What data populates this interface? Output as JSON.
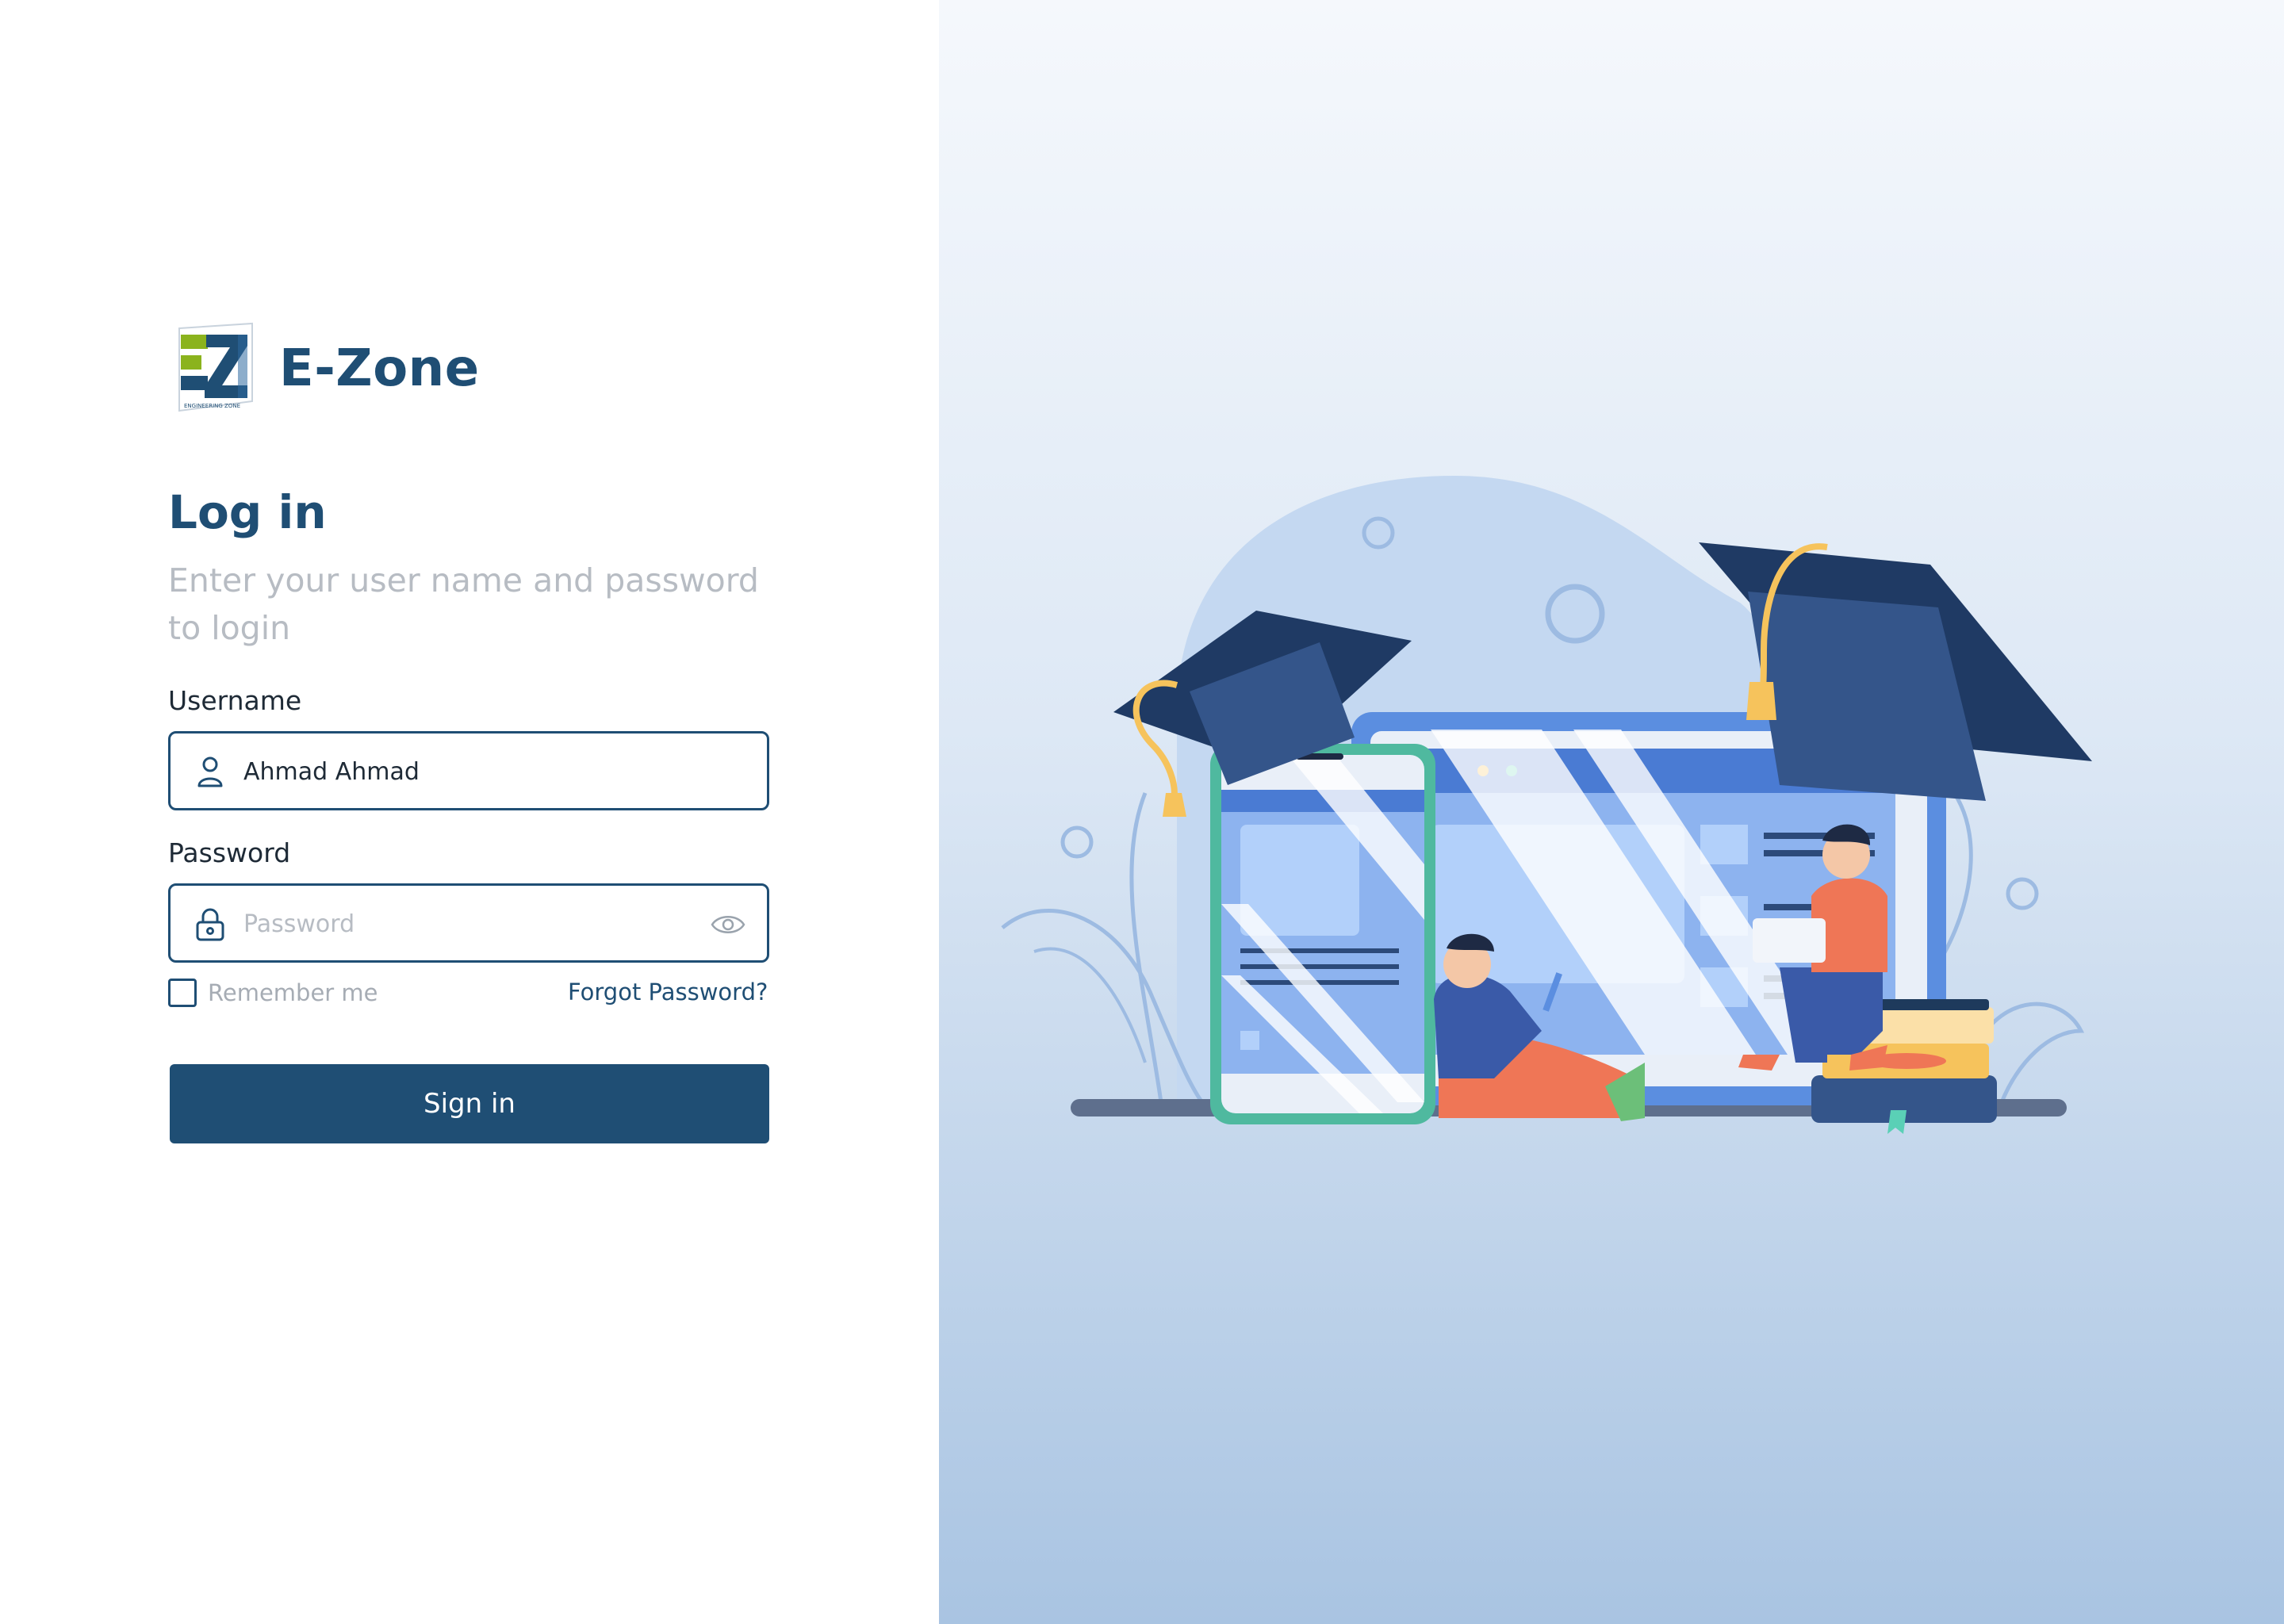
{
  "brand": {
    "name": "E-Zone",
    "logo_letters": "EZ",
    "logo_tagline": "ENGINEERING ZONE"
  },
  "login": {
    "title": "Log in",
    "subtitle": "Enter your user name and password to login",
    "username": {
      "label": "Username",
      "value": "Ahmad Ahmad",
      "icon": "user-icon"
    },
    "password": {
      "label": "Password",
      "value": "",
      "placeholder": "Password",
      "icon": "lock-icon",
      "toggle_icon": "eye-icon"
    },
    "remember_me": {
      "label": "Remember me",
      "checked": false
    },
    "forgot_password": "Forgot Password?",
    "submit": "Sign in"
  },
  "colors": {
    "primary": "#1f4e74",
    "muted_text": "#b7bcc3",
    "logo_green": "#8bb31d",
    "illustration_accent": "#5b8ee0",
    "panel_gradient_top": "#f5f8fc",
    "panel_gradient_bottom": "#a9c4e2"
  },
  "illustration": {
    "subject": "online-education-hero"
  }
}
